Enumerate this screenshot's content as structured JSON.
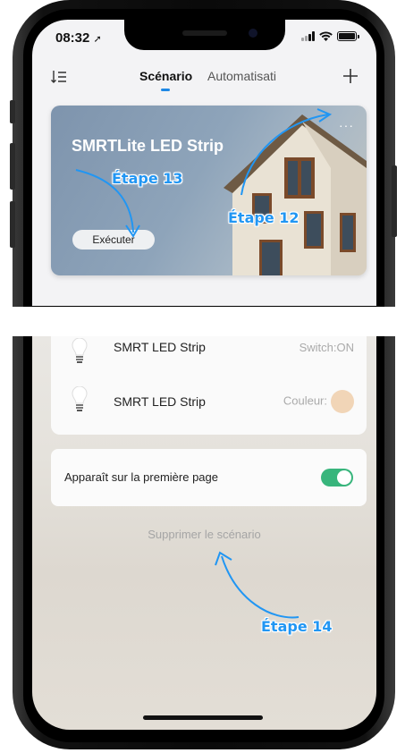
{
  "status": {
    "time": "08:32"
  },
  "nav": {
    "tab_scenario": "Scénario",
    "tab_automation": "Automatisati"
  },
  "scene_card": {
    "title": "SMRTLite LED Strip",
    "dots": "···",
    "execute_label": "Exécuter"
  },
  "annotations": {
    "step13": "Étape 13",
    "step12": "Étape 12",
    "step14": "Étape 14",
    "color": "#2196f3"
  },
  "devices": [
    {
      "name": "SMRT LED Strip",
      "state": "Switch:ON"
    },
    {
      "name": "SMRT LED Strip",
      "state": "Couleur:",
      "swatch_color": "#f1d5b7"
    }
  ],
  "first_page": {
    "label": "Apparaît sur la première page",
    "enabled": true
  },
  "delete_label": "Supprimer le scénario",
  "colors": {
    "accent": "#1e88e5",
    "toggle_on": "#38b57c"
  }
}
